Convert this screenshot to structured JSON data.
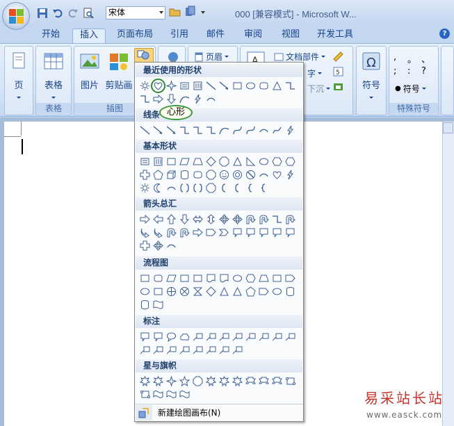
{
  "window": {
    "title": "000 [兼容模式] - Microsoft W...",
    "font_name": "宋体"
  },
  "tabs": [
    "开始",
    "插入",
    "页面布局",
    "引用",
    "邮件",
    "审阅",
    "视图",
    "开发工具"
  ],
  "active_tab": "插入",
  "ribbon": {
    "pages_label": "页",
    "table_label": "表格",
    "table_group": "表格",
    "picture_label": "图片",
    "clipart_label": "剪贴画",
    "illustrations_group": "插图",
    "header_label": "页眉",
    "textbox_label": "文档部件",
    "wordart_label": "字",
    "dropcap_label": "下沉",
    "symbol_label": "符号",
    "special_symbol_label": "符号",
    "special_group": "特殊符号",
    "special_chars": [
      ",",
      "。",
      "、",
      ";",
      ":",
      "?"
    ]
  },
  "shapes_panel": {
    "sections": [
      {
        "title": "最近使用的形状"
      },
      {
        "title": "线条"
      },
      {
        "title": "基本形状"
      },
      {
        "title": "箭头总汇"
      },
      {
        "title": "流程图"
      },
      {
        "title": "标注"
      },
      {
        "title": "星与旗帜"
      }
    ],
    "tooltip": "心形",
    "new_canvas": "新建绘图画布(N)"
  },
  "watermark": {
    "text": "易采站长站",
    "url": "www.easck.com"
  },
  "colors": {
    "highlight": "#2e8a2e",
    "watermark": "#c83028"
  }
}
